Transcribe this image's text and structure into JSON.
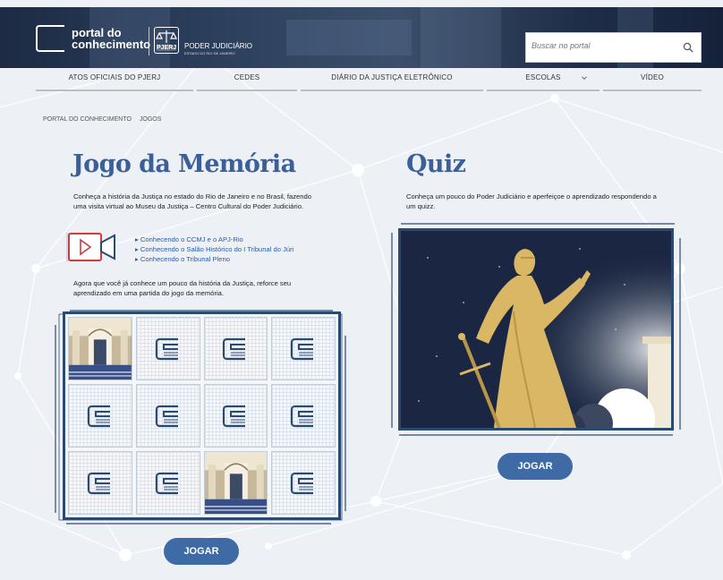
{
  "header": {
    "logo_line1": "portal do",
    "logo_line2": "conhecimento",
    "seal_label": "PJERJ",
    "org_title": "PODER JUDICIÁRIO",
    "org_subtitle": "ESTADO DO RIO DE JANEIRO",
    "search_placeholder": "Buscar no portal"
  },
  "nav": {
    "items": [
      {
        "label": "ATOS OFICIAIS DO PJERJ"
      },
      {
        "label": "CEDES"
      },
      {
        "label": "DIÁRIO DA JUSTIÇA ELETRÔNICO"
      },
      {
        "label": "ESCOLAS"
      },
      {
        "label": "VÍDEO"
      }
    ]
  },
  "breadcrumb": [
    "PORTAL DO CONHECIMENTO",
    "JOGOS"
  ],
  "memory": {
    "title": "Jogo da Memória",
    "intro": "Conheça a história da Justiça no estado do Rio de Janeiro e no Brasil, fazendo uma visita virtual ao Museu da Justiça – Centro Cultural do Poder Judiciário.",
    "links": [
      "Conhecendo o CCMJ e o APJ-Rio",
      "Conhecendo o Salão Histórico do I Tribunal do Júri",
      "Conhecendo o Tribunal Pleno"
    ],
    "outro": "Agora que você já conhece um pouco da história da Justiça, reforce seu aprendizado em uma partida do jogo da memória.",
    "cards": [
      "face",
      "back",
      "back",
      "back",
      "back",
      "back",
      "back",
      "back",
      "back",
      "back",
      "face",
      "back"
    ],
    "button": "JOGAR"
  },
  "quiz": {
    "title": "Quiz",
    "intro": "Conheça um pouco do Poder Judiciário e aperfeiçoe o aprendizado respondendo a um quizz.",
    "button": "JOGAR"
  },
  "colors": {
    "accent": "#3e6aa6",
    "title": "#3b5f99",
    "frame": "#2b4a72"
  }
}
